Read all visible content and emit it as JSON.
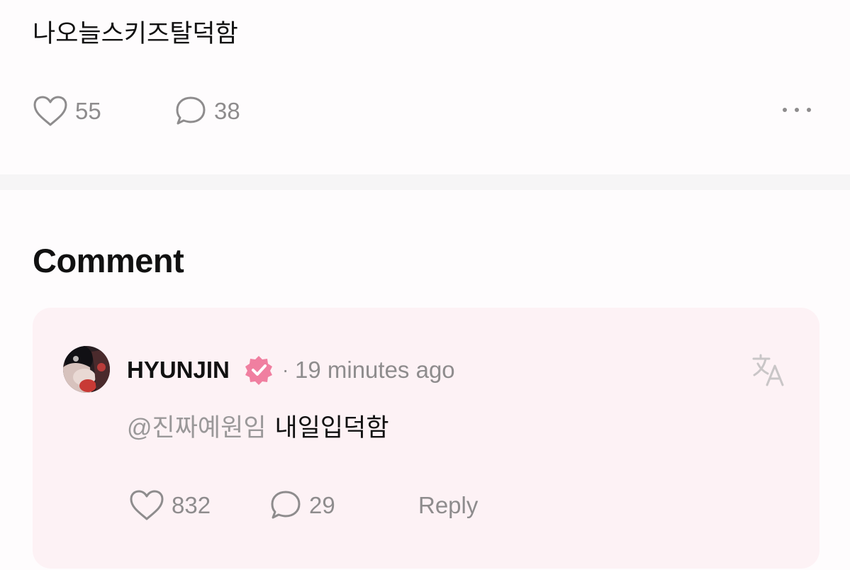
{
  "post": {
    "text": "나오늘스키즈탈덕함",
    "like_count": "55",
    "comment_count": "38",
    "icons": {
      "like": "heart-icon",
      "comment": "speech-bubble-icon",
      "more": "more-horizontal-icon"
    }
  },
  "comments_section": {
    "heading": "Comment",
    "comment": {
      "username": "HYUNJIN",
      "verified": true,
      "separator": "·",
      "timestamp": "19 minutes ago",
      "mention": "@진짜예원임",
      "text": "내일입덕함",
      "like_count": "832",
      "reply_count": "29",
      "reply_label": "Reply",
      "icons": {
        "translate": "translate-icon",
        "verified": "verified-badge-icon",
        "avatar": "avatar"
      }
    }
  },
  "colors": {
    "background": "#fefcfd",
    "card_background": "#fdf2f5",
    "verified_badge": "#f07fa0",
    "muted_text": "#8e8c8d",
    "divider": "#f6f5f6"
  }
}
